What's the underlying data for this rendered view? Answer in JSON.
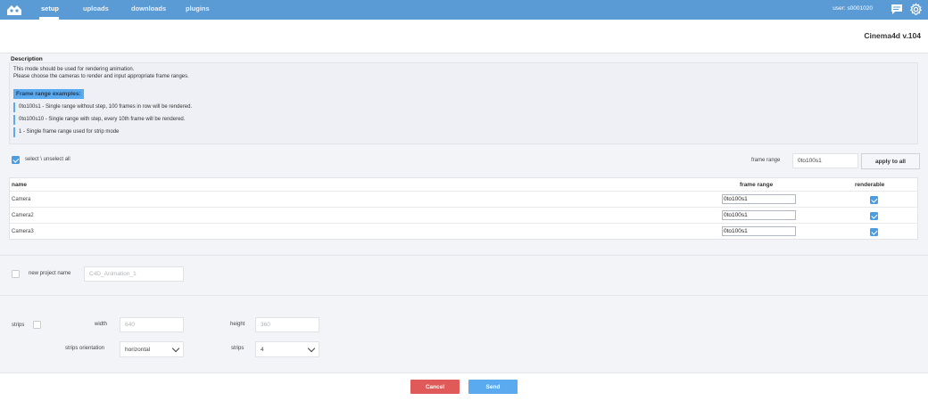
{
  "nav": {
    "items": [
      {
        "label": "setup",
        "active": true
      },
      {
        "label": "uploads",
        "active": false
      },
      {
        "label": "downloads",
        "active": false
      },
      {
        "label": "plugins",
        "active": false
      }
    ],
    "user": "user: s0001020"
  },
  "header": {
    "app_version": "Cinema4d v.104"
  },
  "description": {
    "label": "Description",
    "lines": [
      "This mode should be used for rendering animation.",
      "Please choose the cameras to render and input appropriate frame ranges."
    ],
    "frame_range_title": "Frame range examples:",
    "examples": [
      "0to100s1 - Single range without step, 100 frames in row will be rendered.",
      "0to100s10 - Single range with step, every 10th frame will be rendered.",
      "1 - Single frame range used for strip mode"
    ]
  },
  "selection": {
    "select_all_label": "select \\ unselect all",
    "select_all_checked": true,
    "frame_range_label": "frame range",
    "frame_range_value": "0to100s1",
    "apply_button": "apply to all"
  },
  "table": {
    "headers": {
      "name": "name",
      "frame_range": "frame range",
      "renderable": "renderable"
    },
    "rows": [
      {
        "name": "Camera",
        "frame_range": "0to100s1",
        "renderable": true
      },
      {
        "name": "Camera2",
        "frame_range": "0to100s1",
        "renderable": true
      },
      {
        "name": "Camera3",
        "frame_range": "0to100s1",
        "renderable": true
      }
    ]
  },
  "project": {
    "label": "new project name",
    "checked": false,
    "placeholder": "C4D_Animation_1"
  },
  "strips": {
    "label": "strips",
    "checked": false,
    "width_label": "width",
    "width_value": "640",
    "height_label": "height",
    "height_value": "360",
    "orientation_label": "strips orientation",
    "orientation_value": "horizontal",
    "count_label": "strips",
    "count_value": "4"
  },
  "footer": {
    "cancel": "Cancel",
    "send": "Send"
  },
  "colors": {
    "topbar": "#5b9bd5",
    "accent": "#5aaaf0",
    "cancel": "#e05a5a",
    "checkbox": "#4a9de0"
  }
}
